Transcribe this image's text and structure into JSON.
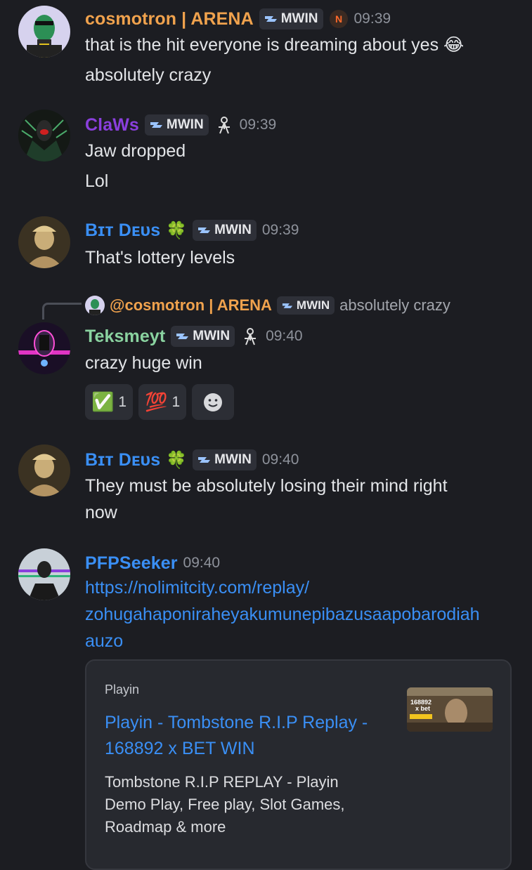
{
  "messages": [
    {
      "username": "cosmotron | ARENA",
      "username_color": "#f0a24d",
      "tag": "MWIN",
      "time": "09:39",
      "lines": [
        "that is the hit everyone is dreaming about yes",
        "absolutely crazy"
      ],
      "emoji": "😂"
    },
    {
      "username": "ClaWs",
      "username_color": "#8a3fdd",
      "tag": "MWIN",
      "time": "09:39",
      "lines": [
        "Jaw dropped",
        "Lol"
      ]
    },
    {
      "username": "Bɪᴛ Dᴇᴜs",
      "username_color": "#3a8ff5",
      "tag": "MWIN",
      "time": "09:39",
      "lines": [
        "That's lottery levels"
      ],
      "badge": "🍀"
    },
    {
      "reply": {
        "mention": "@cosmotron | ARENA",
        "tag": "MWIN",
        "text": "absolutely crazy"
      },
      "username": "Teksmeyt",
      "username_color": "#8ad3a0",
      "tag": "MWIN",
      "time": "09:40",
      "lines": [
        "crazy huge win"
      ],
      "reactions": [
        {
          "emoji": "✅",
          "count": "1"
        },
        {
          "emoji": "💯",
          "count": "1"
        }
      ]
    },
    {
      "username": "Bɪᴛ Dᴇᴜs",
      "username_color": "#3a8ff5",
      "tag": "MWIN",
      "time": "09:40",
      "lines": [
        "They must be absolutely losing their mind right",
        "now"
      ],
      "badge": "🍀"
    },
    {
      "username": "PFPSeeker",
      "username_color": "#3a8ff5",
      "time": "09:40",
      "link_lines": [
        "https://nolimitcity.com/replay/",
        "zohugahaponiraheyakumunepibazusaapobarodiah",
        "auzo"
      ],
      "embed": {
        "provider": "Playin",
        "title_lines": [
          "Playin - Tombstone R.I.P Replay -",
          "168892 x BET WIN"
        ],
        "description_lines": [
          "Tombstone R.I.P REPLAY - Playin",
          "Demo Play, Free play, Slot Games,",
          "Roadmap & more"
        ],
        "thumb_text": [
          "168892",
          "x bet"
        ]
      }
    }
  ]
}
